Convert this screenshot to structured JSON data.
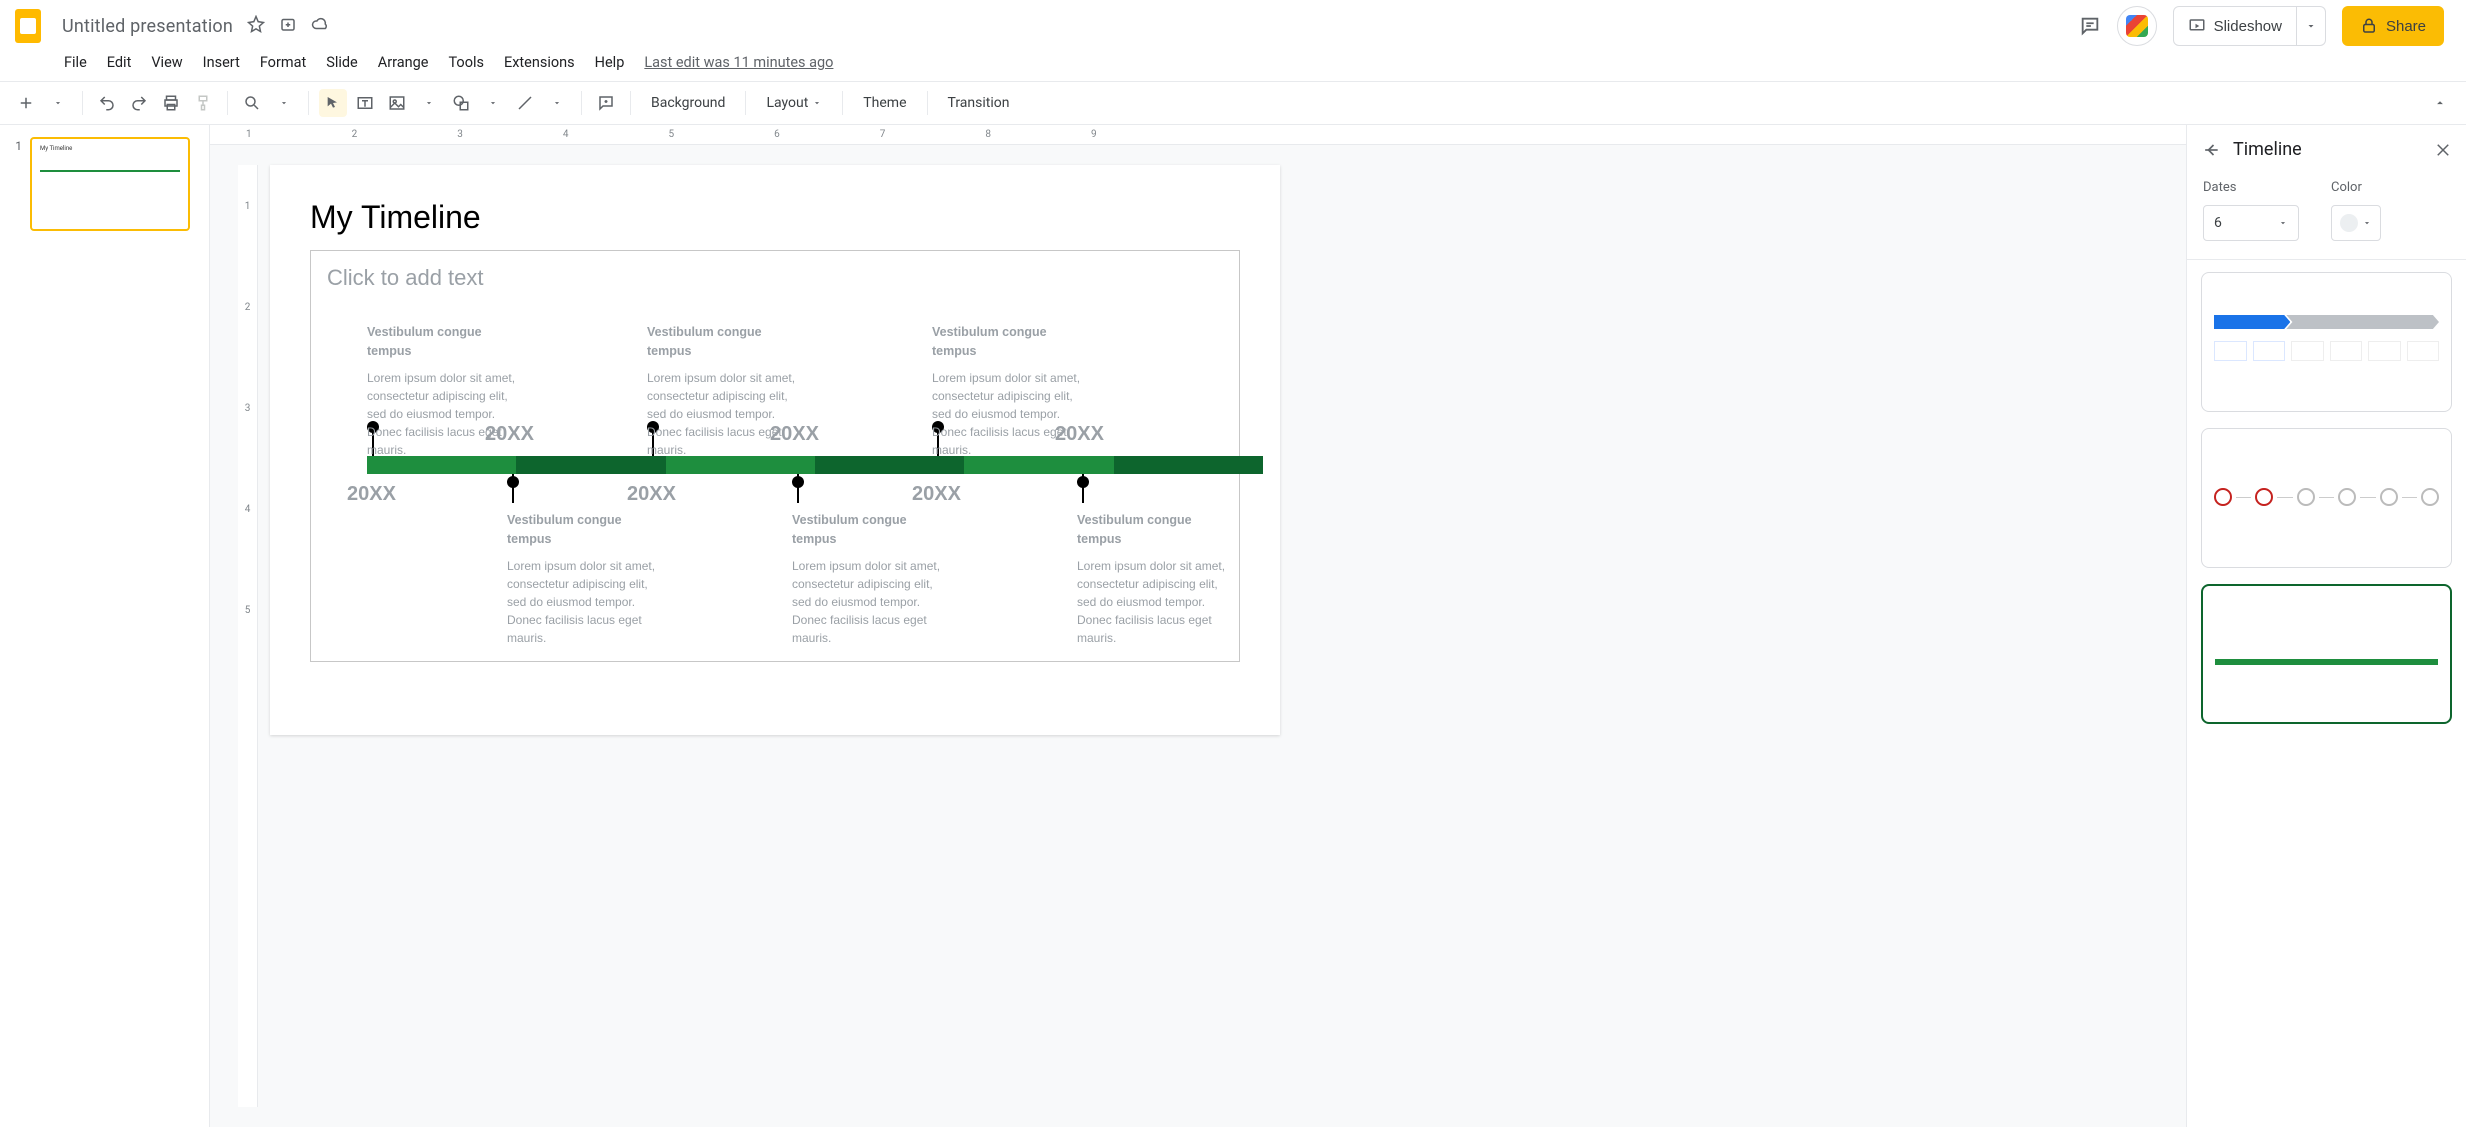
{
  "app": {
    "doc_title": "Untitled presentation",
    "last_edit": "Last edit was 11 minutes ago"
  },
  "menus": [
    "File",
    "Edit",
    "View",
    "Insert",
    "Format",
    "Slide",
    "Arrange",
    "Tools",
    "Extensions",
    "Help"
  ],
  "toolbar": {
    "background": "Background",
    "layout": "Layout",
    "theme": "Theme",
    "transition": "Transition"
  },
  "header_buttons": {
    "slideshow": "Slideshow",
    "share": "Share"
  },
  "filmstrip": {
    "items": [
      {
        "num": "1"
      }
    ]
  },
  "ruler_h": [
    "1",
    "2",
    "3",
    "4",
    "5",
    "6",
    "7",
    "8",
    "9"
  ],
  "ruler_v": [
    "1",
    "2",
    "3",
    "4",
    "5"
  ],
  "slide": {
    "title": "My Timeline",
    "subtitle_placeholder": "Click to add text",
    "events": [
      {
        "year": "20XX",
        "heading": "Vestibulum congue tempus",
        "body": "Lorem ipsum dolor sit amet, consectetur adipiscing elit, sed do eiusmod tempor. Donec facilisis lacus eget mauris."
      },
      {
        "year": "20XX",
        "heading": "Vestibulum congue tempus",
        "body": "Lorem ipsum dolor sit amet, consectetur adipiscing elit, sed do eiusmod tempor. Donec facilisis lacus eget mauris."
      },
      {
        "year": "20XX",
        "heading": "Vestibulum congue tempus",
        "body": "Lorem ipsum dolor sit amet, consectetur adipiscing elit, sed do eiusmod tempor. Donec facilisis lacus eget mauris."
      },
      {
        "year": "20XX",
        "heading": "Vestibulum congue tempus",
        "body": "Lorem ipsum dolor sit amet, consectetur adipiscing elit, sed do eiusmod tempor. Donec facilisis lacus eget mauris."
      },
      {
        "year": "20XX",
        "heading": "Vestibulum congue tempus",
        "body": "Lorem ipsum dolor sit amet, consectetur adipiscing elit, sed do eiusmod tempor. Donec facilisis lacus eget mauris."
      },
      {
        "year": "20XX",
        "heading": "Vestibulum congue tempus",
        "body": "Lorem ipsum dolor sit amet, consectetur adipiscing elit, sed do eiusmod tempor. Donec facilisis lacus eget mauris."
      }
    ]
  },
  "panel": {
    "title": "Timeline",
    "dates_label": "Dates",
    "color_label": "Color",
    "dates_value": "6"
  }
}
